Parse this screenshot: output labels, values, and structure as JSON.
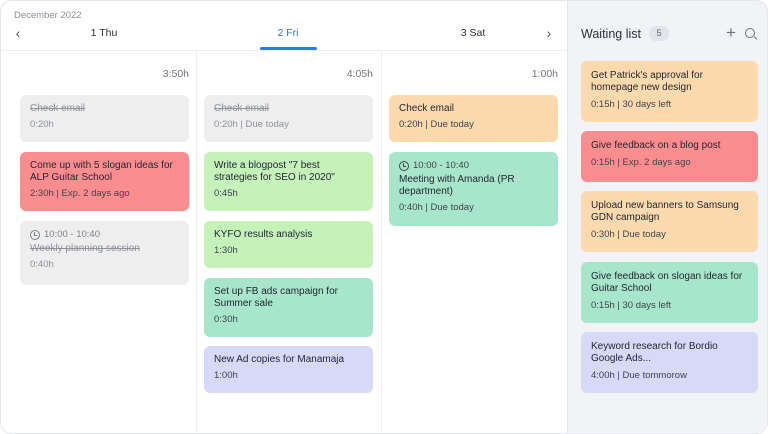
{
  "header": {
    "month": "December 2022",
    "prev_icon": "chevron-left-icon",
    "next_icon": "chevron-right-icon",
    "days": [
      {
        "label": "1 Thu",
        "total": "3:50h",
        "active": false
      },
      {
        "label": "2 Fri",
        "total": "4:05h",
        "active": true
      },
      {
        "label": "3 Sat",
        "total": "1:00h",
        "active": false
      }
    ]
  },
  "colors": {
    "accent": "#2b7be8",
    "gray": "#eeeeef",
    "red": "#fc8d8f",
    "green": "#c5f2b9",
    "teal": "#a8e6cb",
    "peach": "#fdd9ae",
    "lavender": "#d6daf8"
  },
  "columns": [
    {
      "tasks": [
        {
          "title": "Check email",
          "meta": "0:20h",
          "done": true,
          "color": "gray"
        },
        {
          "title": "Come up with 5 slogan ideas for ALP Guitar School",
          "meta": "2:30h | Exp. 2 days ago",
          "done": false,
          "color": "red"
        },
        {
          "time": "10:00 - 10:40",
          "title": "Weekly planning session",
          "meta": "0:40h",
          "done": true,
          "color": "gray"
        }
      ]
    },
    {
      "tasks": [
        {
          "title": "Check email",
          "meta": "0:20h | Due today",
          "done": true,
          "color": "gray"
        },
        {
          "title": "Write a blogpost \"7 best strategies for SEO in 2020\"",
          "meta": "0:45h",
          "done": false,
          "color": "green"
        },
        {
          "title": "KYFO results analysis",
          "meta": "1:30h",
          "done": false,
          "color": "green"
        },
        {
          "title": "Set up FB ads campaign for Summer sale",
          "meta": "0:30h",
          "done": false,
          "color": "teal"
        },
        {
          "title": "New Ad copies for Manamaja",
          "meta": "1:00h",
          "done": false,
          "color": "lavender"
        }
      ]
    },
    {
      "tasks": [
        {
          "title": "Check email",
          "meta": "0:20h | Due today",
          "done": false,
          "color": "peach"
        },
        {
          "time": "10:00 - 10:40",
          "title": "Meeting with Amanda (PR department)",
          "meta": "0:40h | Due today",
          "done": false,
          "color": "teal"
        }
      ]
    }
  ],
  "waiting_list": {
    "title": "Waiting list",
    "count": "5",
    "add_icon": "plus-icon",
    "search_icon": "search-icon",
    "items": [
      {
        "title": "Get Patrick's approval for homepage new design",
        "meta": "0:15h | 30 days left",
        "color": "peach"
      },
      {
        "title": "Give feedback on a blog post",
        "meta": "0:15h | Exp. 2 days ago",
        "color": "red"
      },
      {
        "title": "Upload new banners to Samsung GDN campaign",
        "meta": "0:30h | Due today",
        "color": "peach"
      },
      {
        "title": "Give feedback on slogan ideas for Guitar School",
        "meta": "0:15h | 30 days left",
        "color": "teal"
      },
      {
        "title": "Keyword research for Bordio Google Ads...",
        "meta": "4:00h | Due tommorow",
        "color": "lavender"
      }
    ]
  }
}
